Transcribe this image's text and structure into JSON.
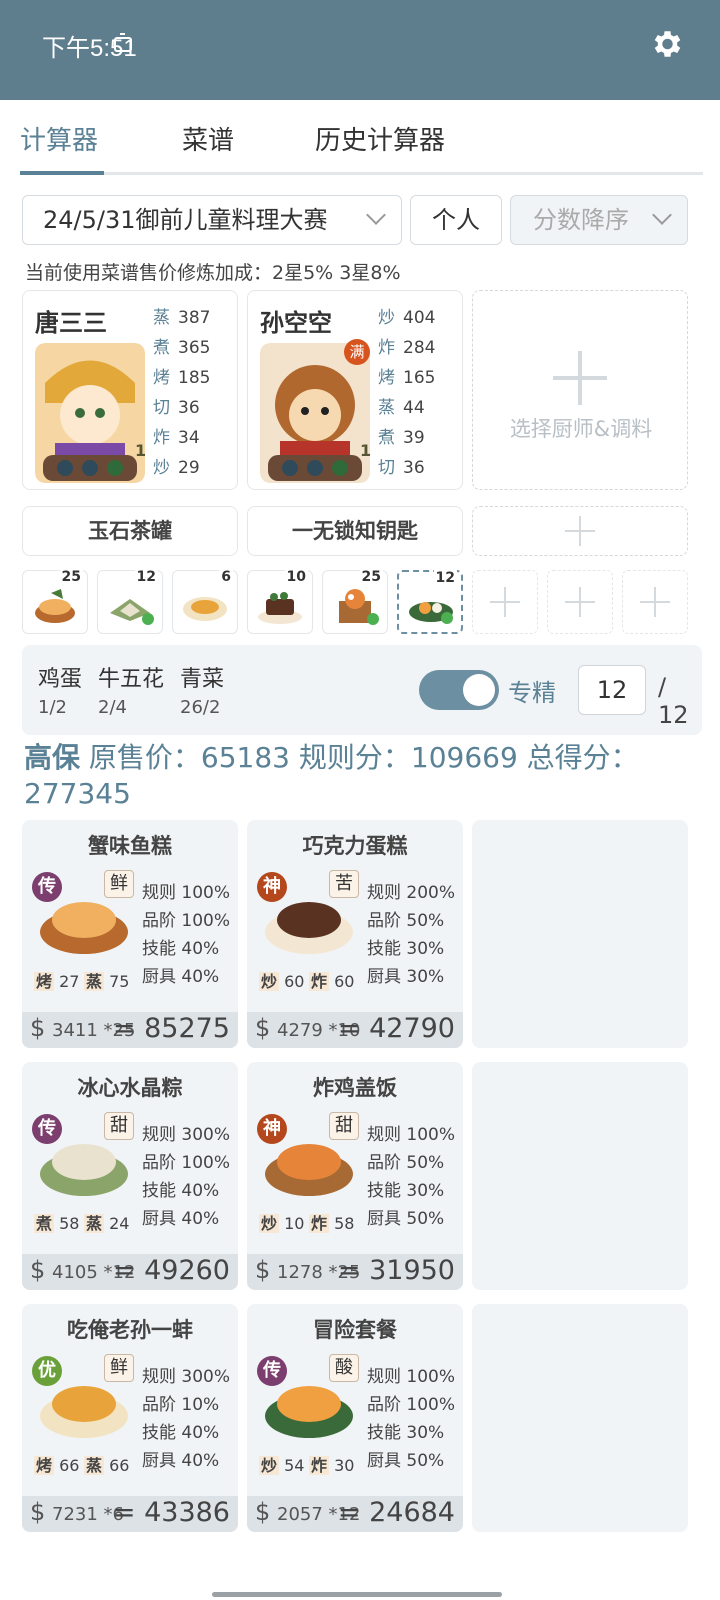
{
  "status_bar": {
    "time": "下午5:51"
  },
  "tabs": [
    "计算器",
    "菜谱",
    "历史计算器"
  ],
  "filters": {
    "contest": "24/5/31御前儿童料理大赛",
    "mode": "个人",
    "sort": "分数降序"
  },
  "note": "当前使用菜谱售价修炼加成：2星5% 3星8%",
  "chefs": [
    {
      "name": "唐三三",
      "level": "1",
      "stats": [
        [
          "蒸",
          "387"
        ],
        [
          "煮",
          "365"
        ],
        [
          "烤",
          "185"
        ],
        [
          "切",
          "36"
        ],
        [
          "炸",
          "34"
        ],
        [
          "炒",
          "29"
        ]
      ]
    },
    {
      "name": "孙空空",
      "level": "1",
      "badge": "满",
      "stats": [
        [
          "炒",
          "404"
        ],
        [
          "炸",
          "284"
        ],
        [
          "烤",
          "165"
        ],
        [
          "蒸",
          "44"
        ],
        [
          "煮",
          "39"
        ],
        [
          "切",
          "36"
        ]
      ]
    }
  ],
  "chef_add_label": "选择厨师&调料",
  "equipment": [
    "玉石茶罐",
    "一无锁知钥匙"
  ],
  "recipe_slots": [
    "25",
    "12",
    "6",
    "10",
    "25",
    "12"
  ],
  "ingredients": [
    {
      "name": "鸡蛋",
      "qty": "1/2"
    },
    {
      "name": "牛五花",
      "qty": "2/4"
    },
    {
      "name": "青菜",
      "qty": "26/2"
    }
  ],
  "specialize": {
    "label": "专精",
    "value": "12",
    "max": "/ 12"
  },
  "summary": {
    "name": "高保",
    "text": "原售价：65183 规则分：109669 总得分：277345"
  },
  "recipes": [
    {
      "name": "蟹味鱼糕",
      "grade": "传",
      "grade_color": "#7b3e6e",
      "flavor": "鲜",
      "rule": "规则 100%",
      "tier": "品阶 100%",
      "skill": "技能 40%",
      "tool": "厨具 40%",
      "s1k": "烤",
      "s1v": "27",
      "s2k": "蒸",
      "s2v": "75",
      "price": "3411 *25",
      "total": "= 85275"
    },
    {
      "name": "巧克力蛋糕",
      "grade": "神",
      "grade_color": "#b4481c",
      "flavor": "苦",
      "rule": "规则 200%",
      "tier": "品阶 50%",
      "skill": "技能 30%",
      "tool": "厨具 30%",
      "s1k": "炒",
      "s1v": "60",
      "s2k": "炸",
      "s2v": "60",
      "price": "4279 *10",
      "total": "= 42790"
    },
    {
      "name": "冰心水晶粽",
      "grade": "传",
      "grade_color": "#7b3e6e",
      "flavor": "甜",
      "rule": "规则 300%",
      "tier": "品阶 100%",
      "skill": "技能 40%",
      "tool": "厨具 40%",
      "s1k": "煮",
      "s1v": "58",
      "s2k": "蒸",
      "s2v": "24",
      "price": "4105 *12",
      "total": "= 49260"
    },
    {
      "name": "炸鸡盖饭",
      "grade": "神",
      "grade_color": "#b4481c",
      "flavor": "甜",
      "rule": "规则 100%",
      "tier": "品阶 50%",
      "skill": "技能 30%",
      "tool": "厨具 50%",
      "s1k": "炒",
      "s1v": "10",
      "s2k": "炸",
      "s2v": "58",
      "price": "1278 *25",
      "total": "= 31950"
    },
    {
      "name": "吃俺老孙一蚌",
      "grade": "优",
      "grade_color": "#6aa03a",
      "flavor": "鲜",
      "rule": "规则 300%",
      "tier": "品阶 10%",
      "skill": "技能 40%",
      "tool": "厨具 40%",
      "s1k": "烤",
      "s1v": "66",
      "s2k": "蒸",
      "s2v": "66",
      "price": "7231 *6",
      "total": "= 43386"
    },
    {
      "name": "冒险套餐",
      "grade": "传",
      "grade_color": "#7b3e6e",
      "flavor": "酸",
      "rule": "规则 100%",
      "tier": "品阶 100%",
      "skill": "技能 30%",
      "tool": "厨具 50%",
      "s1k": "炒",
      "s1v": "54",
      "s2k": "炸",
      "s2v": "30",
      "price": "2057 *12",
      "total": "= 24684"
    }
  ],
  "currency": "$"
}
